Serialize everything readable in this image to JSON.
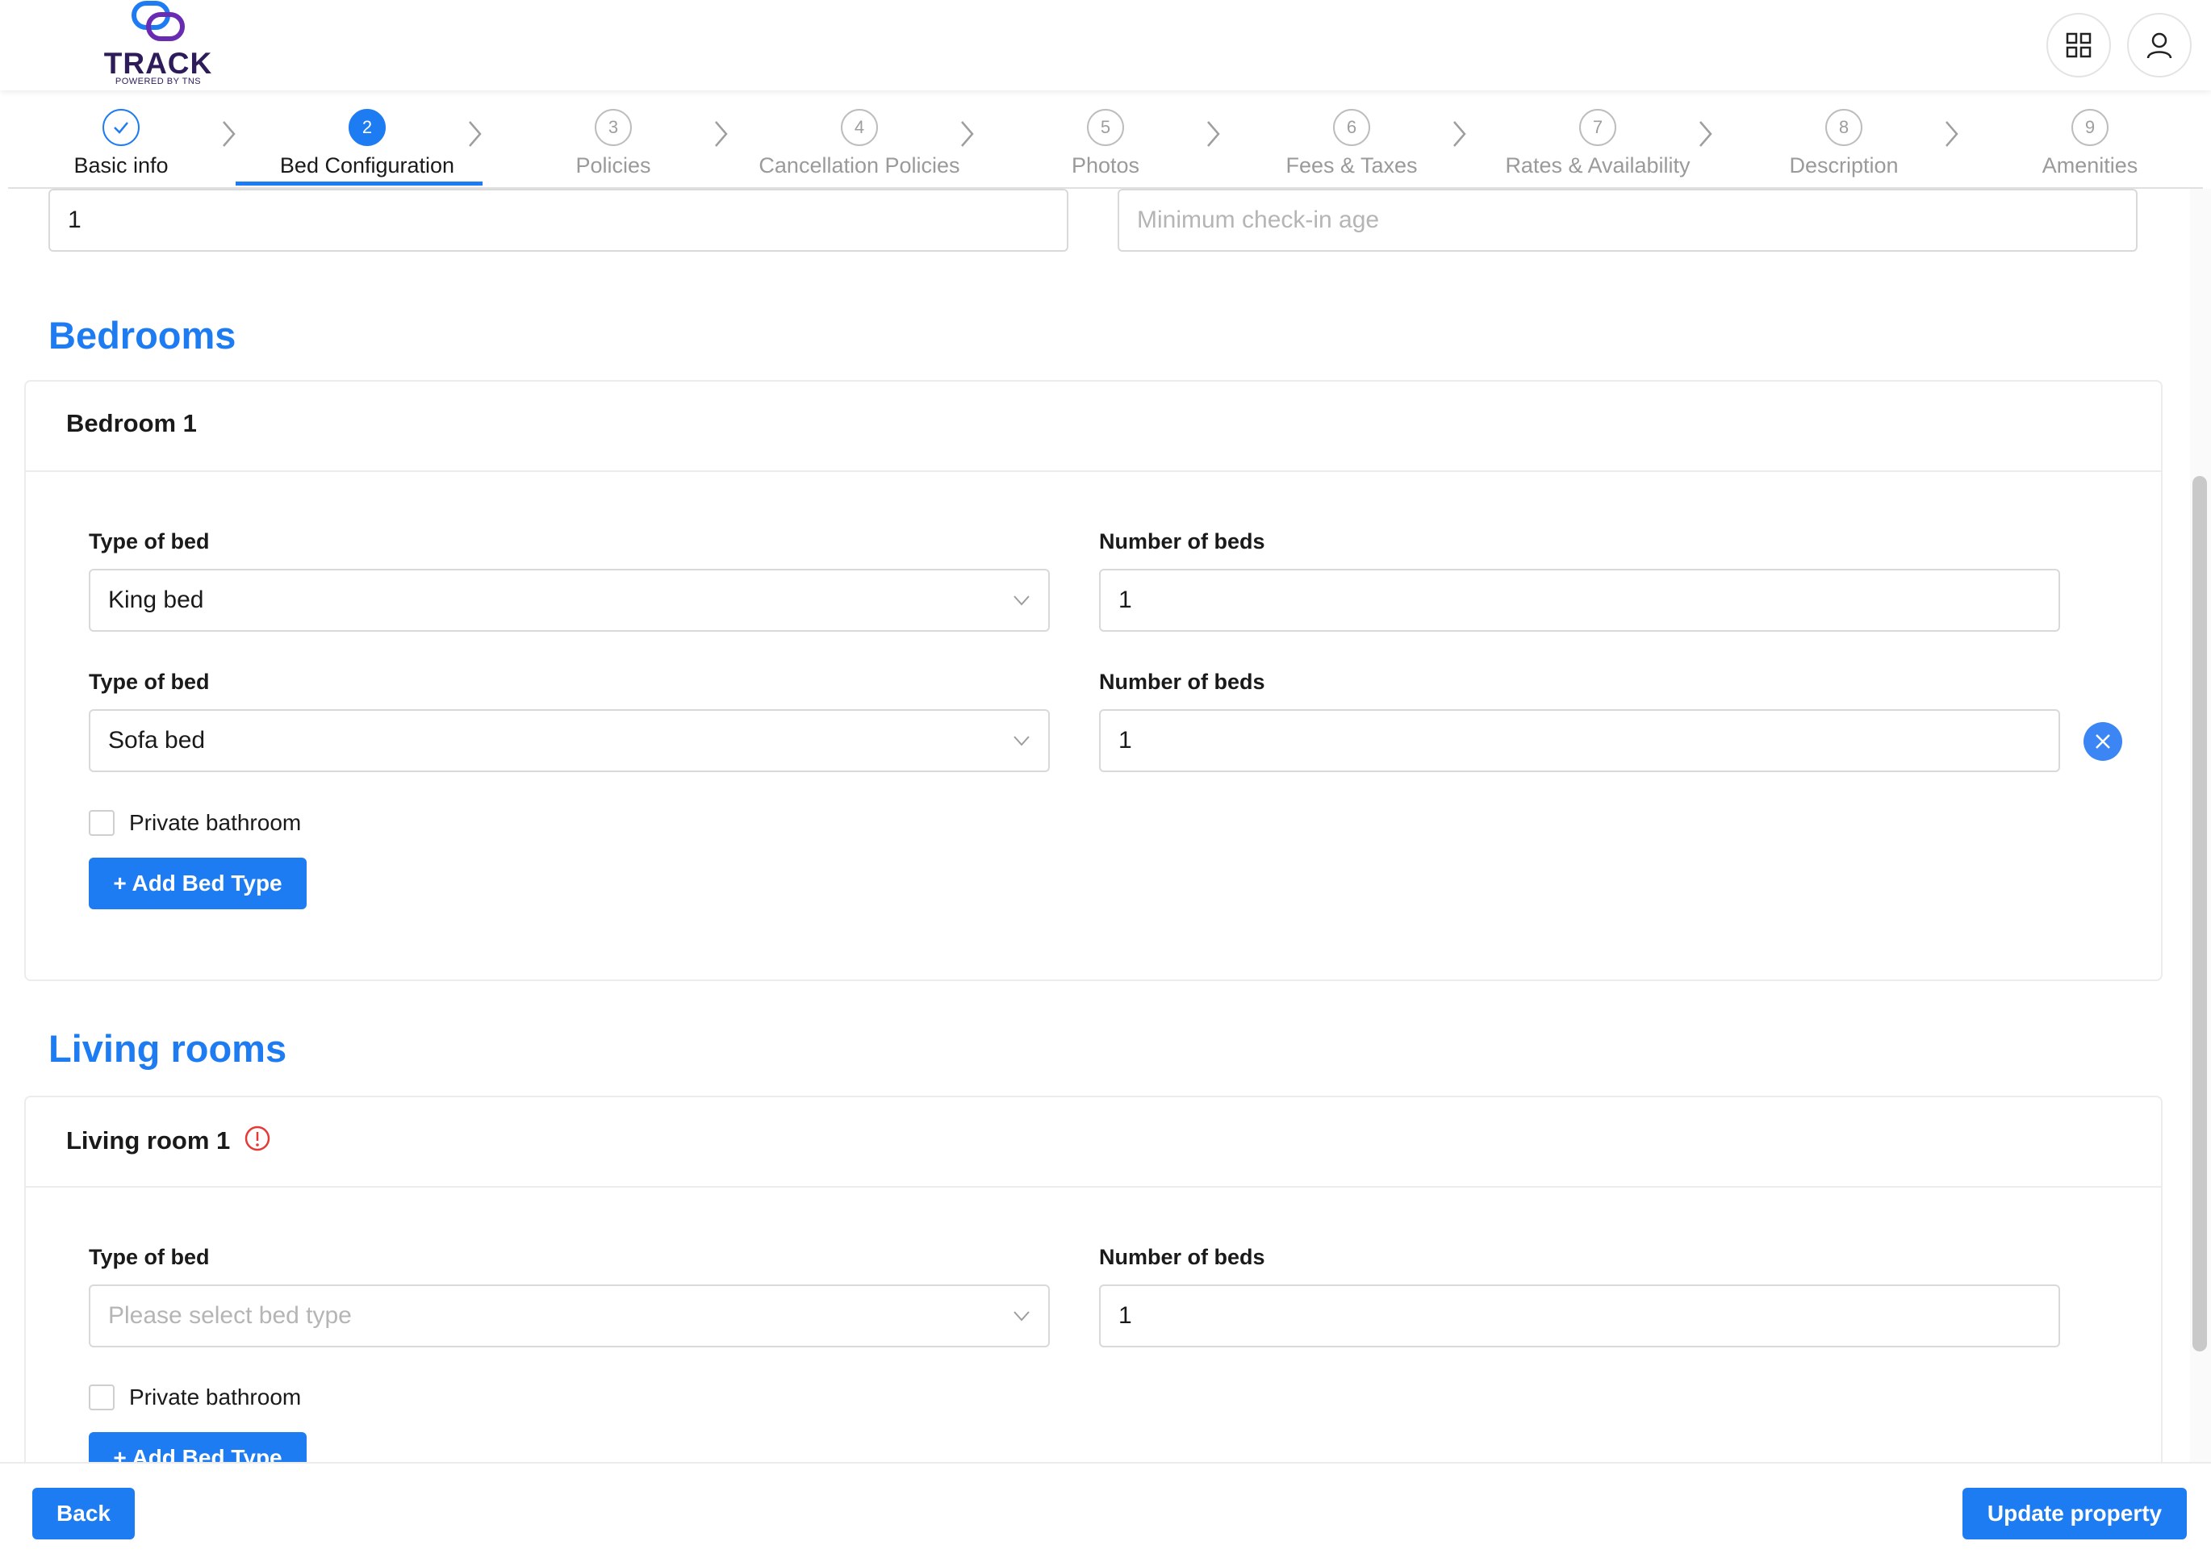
{
  "app": {
    "logo_text": "TRACK",
    "logo_subtext": "POWERED BY TNS"
  },
  "header": {
    "apps_icon": "grid-icon",
    "user_icon": "user-icon"
  },
  "stepper": {
    "steps": [
      {
        "number": "1",
        "label": "Basic info",
        "state": "completed"
      },
      {
        "number": "2",
        "label": "Bed Configuration",
        "state": "active"
      },
      {
        "number": "3",
        "label": "Policies",
        "state": "pending"
      },
      {
        "number": "4",
        "label": "Cancellation Policies",
        "state": "pending"
      },
      {
        "number": "5",
        "label": "Photos",
        "state": "pending"
      },
      {
        "number": "6",
        "label": "Fees & Taxes",
        "state": "pending"
      },
      {
        "number": "7",
        "label": "Rates & Availability",
        "state": "pending"
      },
      {
        "number": "8",
        "label": "Description",
        "state": "pending"
      },
      {
        "number": "9",
        "label": "Amenities",
        "state": "pending"
      }
    ]
  },
  "top_fields": {
    "first_value": "1",
    "min_checkin_placeholder": "Minimum check-in age"
  },
  "bedrooms": {
    "section_title": "Bedrooms",
    "card_title": "Bedroom 1",
    "rows": [
      {
        "type_label": "Type of bed",
        "type_value": "King bed",
        "count_label": "Number of beds",
        "count_value": "1"
      },
      {
        "type_label": "Type of bed",
        "type_value": "Sofa bed",
        "count_label": "Number of beds",
        "count_value": "1"
      }
    ],
    "private_bathroom_label": "Private bathroom",
    "add_bed_type_label": "+ Add Bed Type"
  },
  "living_rooms": {
    "section_title": "Living rooms",
    "card_title": "Living room 1",
    "rows": [
      {
        "type_label": "Type of bed",
        "type_placeholder": "Please select bed type",
        "count_label": "Number of beds",
        "count_value": "1"
      }
    ],
    "private_bathroom_label": "Private bathroom",
    "add_bed_type_label": "+ Add Bed Type"
  },
  "footer": {
    "back_label": "Back",
    "update_label": "Update property"
  },
  "colors": {
    "primary": "#1e7cf2",
    "error": "#e53935",
    "logo": "#2d1b5a"
  }
}
